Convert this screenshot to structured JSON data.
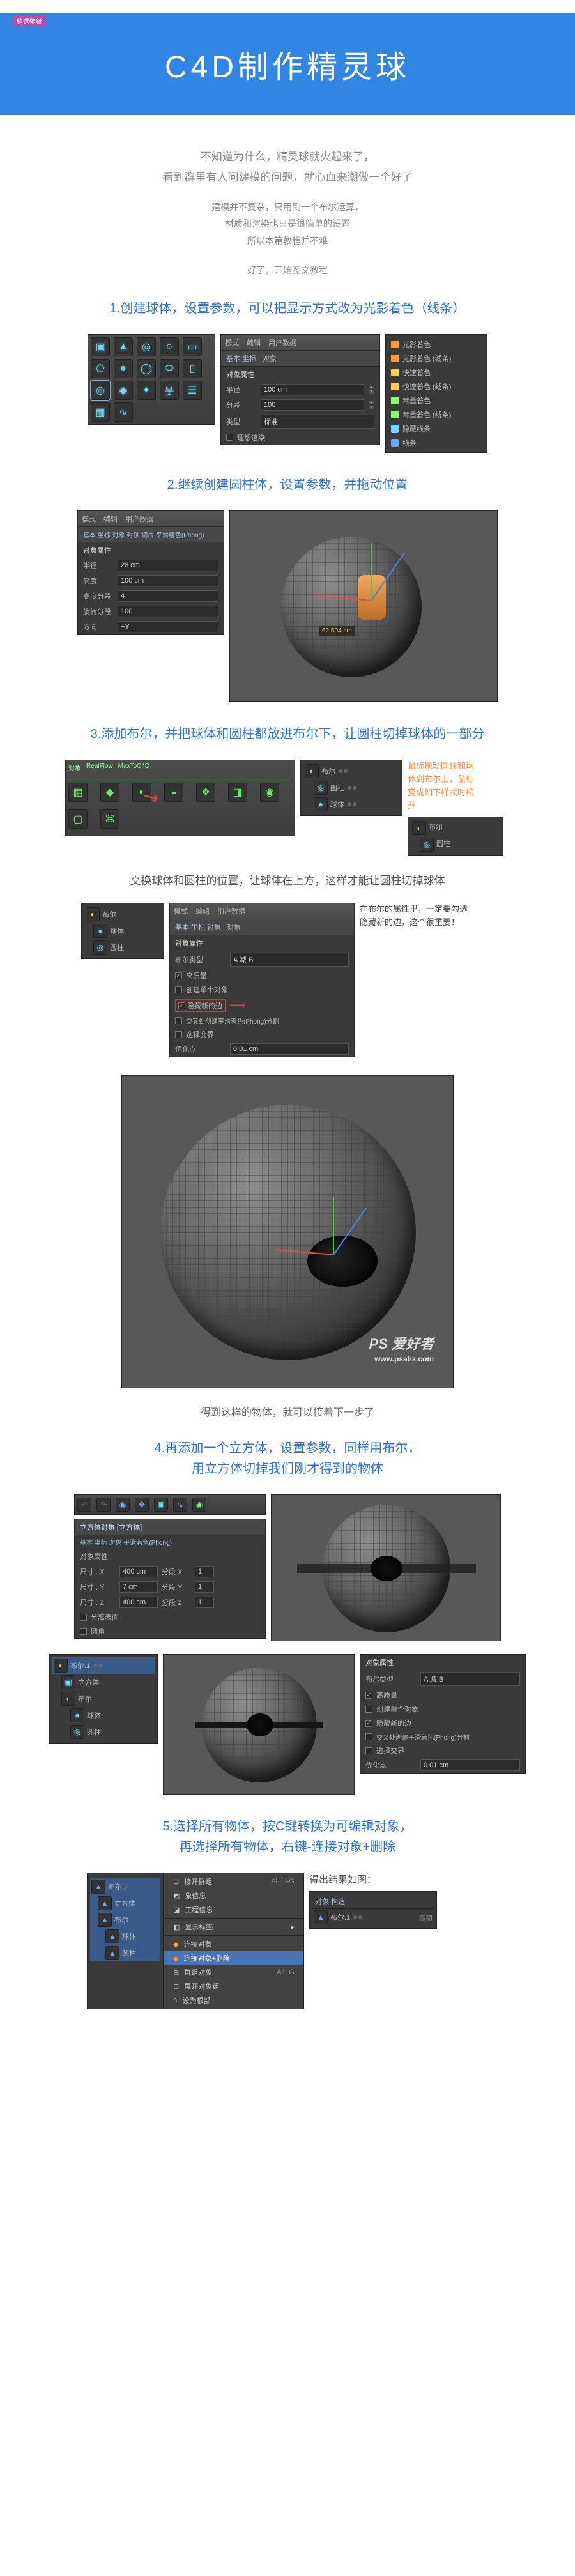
{
  "corner_badge": "精選壁紙",
  "header_title": "C4D制作精灵球",
  "intro": {
    "line1": "不知道为什么，精灵球就火起来了，",
    "line2": "看到群里有人问建模的问题，就心血来潮做一个好了",
    "small1": "建模并不复杂，只用到一个布尔运算，",
    "small2": "材质和渲染也只是很简单的设置",
    "small3": "所以本篇教程并不难",
    "start": "好了，开始图文教程"
  },
  "step1": {
    "title": "1.创建球体，设置参数，可以把显示方式改为光影着色（线条）",
    "panel_tabs": [
      "模式",
      "编辑",
      "用户数据"
    ],
    "attr_tab1": "基本  坐标",
    "attr_tab2": "对象",
    "attr_header": "对象属性",
    "radius_label": "半径",
    "radius_val": "100 cm",
    "seg_label": "分段",
    "seg_val": "100",
    "type_label": "类型",
    "type_val": "标准",
    "ideal_label": "理想渲染",
    "display_list": {
      "a": "光影着色",
      "b": "光影着色 (线条)",
      "c": "快速着色",
      "d": "快速着色 (线条)",
      "e": "常量着色",
      "f": "常量着色 (线条)",
      "g": "隐藏线条",
      "h": "线条"
    },
    "shelf_labels": [
      "立方体",
      "圆锥",
      "圆柱",
      "圆盘",
      "平面",
      "多边形",
      "球体",
      "圆环",
      "胶囊",
      "油桶",
      "管道",
      "角锥",
      "宝石",
      "人偶",
      "地形",
      "地貌",
      "贝塞尔"
    ]
  },
  "step2": {
    "title": "2.继续创建圆柱体，设置参数，并拖动位置",
    "panel_tabs": [
      "模式",
      "编辑",
      "用户数据"
    ],
    "attr_tabs": "基本  坐标  对象  封顶  切片  平滑着色(Phong)",
    "attr_tab_sel": "对象",
    "attr_header": "对象属性",
    "radius_label": "半径",
    "radius_val": "28 cm",
    "height_label": "高度",
    "height_val": "100 cm",
    "hseg_label": "高度分段",
    "hseg_val": "4",
    "rseg_label": "旋转分段",
    "rseg_val": "100",
    "dir_label": "方向",
    "dir_val": "+Y",
    "measure": "62.504 cm"
  },
  "step3": {
    "title": "3.添加布尔，并把球体和圆柱都放进布尔下，让圆柱切掉球体的一部分",
    "menu_items": [
      "阵列",
      "晶格",
      "布尔",
      "样条布尔",
      "连接",
      "实例",
      "融球",
      "对称",
      "Python 生成器"
    ],
    "boole_panel_items": [
      "布尔",
      "圆柱",
      "球体"
    ],
    "side_note1": "鼠标拖动圆柱和球",
    "side_note2": "体到布尔上，鼠标",
    "side_note3": "变成如下样式时松",
    "side_note4": "开",
    "sub_note": "交换球体和圆柱的位置，让球体在上方，这样才能让圆柱切掉球体",
    "panel_tabs": [
      "模式",
      "编辑",
      "用户数据"
    ],
    "attr_tabs": "基本  坐标  对象",
    "attr_tab_sel": "对象",
    "attr_header": "对象属性",
    "bool_type_label": "布尔类型",
    "bool_type_val": "A 减 B",
    "hq_label": "高质量",
    "single_label": "创建单个对象",
    "hide_label": "隐藏新的边",
    "intersect_label": "交叉处创建平滑着色(Phong)分割",
    "sel_label": "选择交界",
    "opt_label": "优化点",
    "opt_val": "0.01 cm",
    "side_hint1": "在布尔的属性里，一定要勾选",
    "side_hint2": "隐藏新的边，这个很重要！",
    "result_note": "得到这样的物体，就可以接着下一步了"
  },
  "step4": {
    "title_a": "4.再添加一个立方体，设置参数，同样用布尔，",
    "title_b": "用立方体切掉我们刚才得到的物体",
    "cube_panel_title": "立方体对象 [立方体]",
    "cube_tabs": "基本  坐标  对象  平滑着色(Phong)",
    "cube_header": "对象属性",
    "sx_label": "尺寸 . X",
    "sx": "400 cm",
    "sxseg_label": "分段 X",
    "sxseg": "1",
    "sy_label": "尺寸 . Y",
    "sy": "7 cm",
    "syseg_label": "分段 Y",
    "syseg": "1",
    "sz_label": "尺寸 . Z",
    "sz": "400 cm",
    "szseg_label": "分段 Z",
    "szseg": "1",
    "sep_label": "分离表面",
    "round_label": "圆角",
    "hier_items": [
      "布尔.1",
      "立方体",
      "布尔",
      "球体",
      "圆柱"
    ],
    "bool_panel_header": "对象属性",
    "bool_type_label": "布尔类型",
    "bool_type_val": "A 减 B",
    "hq_label": "高质量",
    "single_label": "创建单个对象",
    "hide_label": "隐藏新的边",
    "intersect_label": "交叉处创建平滑着色(Phong)分割",
    "sel_label": "选择交界",
    "opt_label": "优化点",
    "opt_val": "0.01 cm"
  },
  "step5": {
    "title_a": "5.选择所有物体，按C键转换为可编辑对象，",
    "title_b": "再选择所有物体，右键-连接对象+删除",
    "result_label": "得出结果如图：",
    "result_tabs": "对象  构造",
    "result_item": "布尔.1",
    "ctx": {
      "a": "接开群组",
      "a_k": "Shift+G",
      "b": "象信息",
      "c": "工程信息",
      "d": "显示标签",
      "e": "连接对象",
      "f": "连接对象+删除",
      "g": "群组对象",
      "g_k": "Alt+G",
      "h": "展开对象组",
      "i": "设为根部"
    }
  },
  "watermarks": {
    "main": "PS 爱好者",
    "url": "www.psahz.com"
  }
}
